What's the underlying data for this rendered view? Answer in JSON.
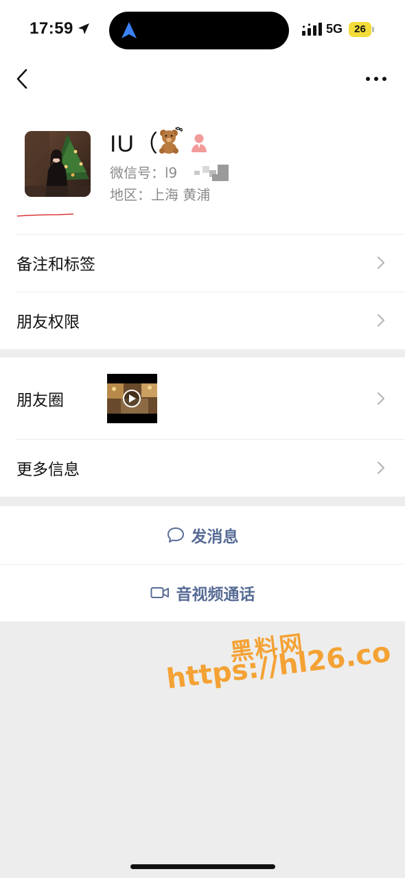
{
  "status_bar": {
    "time": "17:59",
    "network": "5G",
    "battery": "26"
  },
  "profile": {
    "nickname": "IU（",
    "wechat_id": "微信号：l9",
    "region": "地区：上海 黄浦"
  },
  "menu_group_1": {
    "items": [
      {
        "label": "备注和标签"
      },
      {
        "label": "朋友权限"
      }
    ]
  },
  "menu_group_2": {
    "moments_label": "朋友圈",
    "more_info_label": "更多信息"
  },
  "actions": {
    "send_message": "发消息",
    "video_call": "音视频通话"
  },
  "watermark": {
    "title": "黑料网",
    "url": "https://hl26.co"
  },
  "colors": {
    "link_blue": "#576b95",
    "background_gray": "#ededed",
    "battery_yellow": "#f2dc3a",
    "watermark_orange": "#f4a234"
  },
  "icons": {
    "back": "chevron-left-icon",
    "more": "ellipsis-icon",
    "chevron": "chevron-right-icon",
    "message": "chat-bubble-icon",
    "video": "video-camera-icon",
    "gender": "female-icon",
    "emoji": "teddy-bear-icon"
  }
}
